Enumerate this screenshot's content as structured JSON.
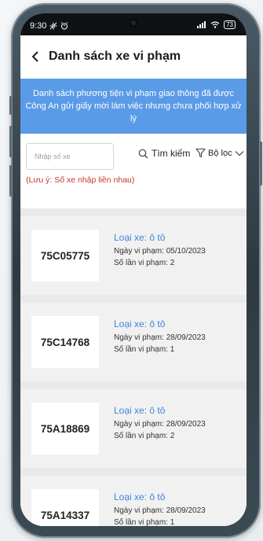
{
  "status_bar": {
    "time": "9:30",
    "battery": "73"
  },
  "header": {
    "title": "Danh sách xe vi phạm"
  },
  "banner": {
    "text": "Danh sách phương tiện vi phạm giao thông đã được Công An gửi giấy mời làm việc nhưng chưa phối hợp xử lý"
  },
  "filters": {
    "search_placeholder": "Nhập số xe",
    "search_value": "",
    "search_label": "Tìm kiếm",
    "filter_label": "Bộ lọc",
    "note": "(Lưu ý: Số xe nhập liền nhau)"
  },
  "vehicles": [
    {
      "plate": "75C05775",
      "type": "Loại xe: ô tô",
      "date": "Ngày vi phạm: 05/10/2023",
      "count": "Số lần vi phạm: 2"
    },
    {
      "plate": "75C14768",
      "type": "Loại xe: ô tô",
      "date": "Ngày vi phạm: 28/09/2023",
      "count": "Số lần vi phạm: 1"
    },
    {
      "plate": "75A18869",
      "type": "Loại xe: ô tô",
      "date": "Ngày vi phạm: 28/09/2023",
      "count": "Số lần vi phạm: 2"
    },
    {
      "plate": "75A14337",
      "type": "Loại xe: ô tô",
      "date": "Ngày vi phạm: 28/09/2023",
      "count": "Số lần vi phạm: 1"
    }
  ],
  "colors": {
    "banner": "#5a9be7",
    "vehicle_type": "#3f86d8",
    "note": "#c0392b"
  }
}
